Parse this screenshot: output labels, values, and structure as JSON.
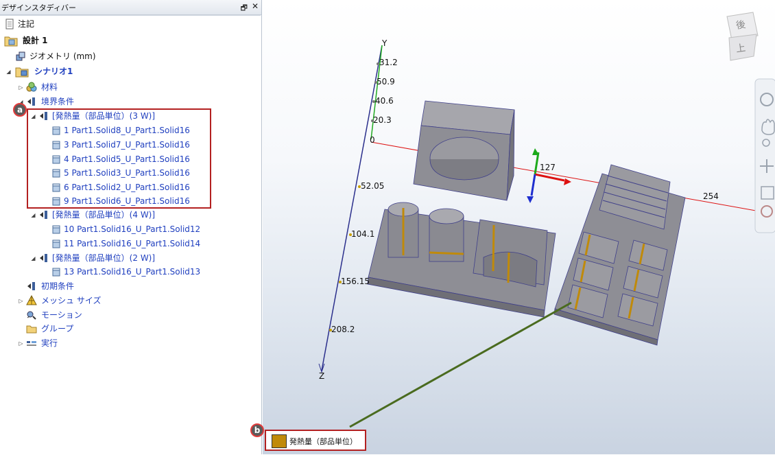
{
  "panel": {
    "title": "デザインスタディバー",
    "pin_glyph": "🗗",
    "close_glyph": "✕"
  },
  "tree": {
    "notes": "注記",
    "design": "設計 1",
    "geometry": "ジオメトリ (mm)",
    "scenario": "シナリオ1",
    "materials": "材料",
    "boundary": "境界条件",
    "heat3": "[発熱量（部品単位）(3 W)]",
    "items3": [
      "1 Part1.Solid8_U_Part1.Solid16",
      "3 Part1.Solid7_U_Part1.Solid16",
      "4 Part1.Solid5_U_Part1.Solid16",
      "5 Part1.Solid3_U_Part1.Solid16",
      "6 Part1.Solid2_U_Part1.Solid16",
      "9 Part1.Solid6_U_Part1.Solid16"
    ],
    "heat4": "[発熱量（部品単位）(4 W)]",
    "items4": [
      "10 Part1.Solid16_U_Part1.Solid12",
      "11 Part1.Solid16_U_Part1.Solid14"
    ],
    "heat2": "[発熱量（部品単位）(2 W)]",
    "items2": [
      "13 Part1.Solid16_U_Part1.Solid13"
    ],
    "initial": "初期条件",
    "mesh": "メッシュ サイズ",
    "motion": "モーション",
    "groups": "グループ",
    "run": "実行"
  },
  "callouts": {
    "a": "a",
    "b": "b"
  },
  "viewport": {
    "axis_y": "Y",
    "axis_z": "Z",
    "ticks": [
      "31.2",
      "50.9",
      "40.6",
      "20.3",
      "0",
      "52.05",
      "104.1",
      "156.15",
      "208.2"
    ],
    "x_ticks": [
      "127",
      "254"
    ],
    "viewcube_top": "上",
    "viewcube_side": "後"
  },
  "legend": {
    "label": "発熱量（部品単位）",
    "color": "#c08a0a"
  },
  "colors": {
    "selected_text": "#1f3fbf",
    "highlight_box": "#b32020",
    "part_fill": "#8e8e95",
    "heat_stripe": "#c08a0a"
  }
}
